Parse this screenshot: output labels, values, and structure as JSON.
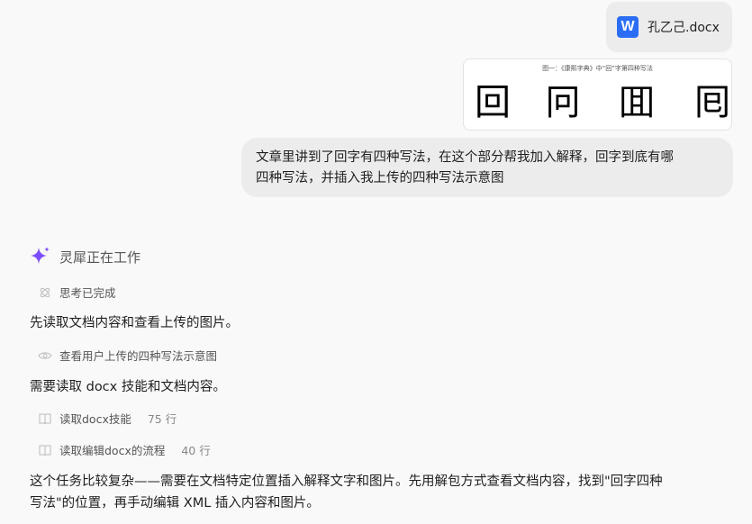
{
  "attachment": {
    "icon_letter": "W",
    "file_name": "孔乙己.docx"
  },
  "image_preview": {
    "caption": "图一：《康熙字典》中“回”字第四种写法",
    "glyphs": [
      "回",
      "冋",
      "囬",
      "囘"
    ]
  },
  "user_message": {
    "line1": "文章里讲到了回字有四种写法，在这个部分帮我加入解释，回字到底有哪",
    "line2": "四种写法，并插入我上传的四种写法示意图"
  },
  "assistant": {
    "status": "灵犀正在工作",
    "thinking_done": "思考已完成",
    "para1": "先读取文档内容和查看上传的图片。",
    "view_image_step": "查看用户上传的四种写法示意图",
    "para2": "需要读取 docx 技能和文档内容。",
    "steps": [
      {
        "label": "读取docx技能",
        "count": "75 行"
      },
      {
        "label": "读取编辑docx的流程",
        "count": "40 行"
      }
    ],
    "para3_line1": "这个任务比较复杂——需要在文档特定位置插入解释文字和图片。先用解包方式查看文档内容，找到\"回字四种",
    "para3_line2": "写法\"的位置，再手动编辑 XML 插入内容和图片。"
  },
  "colors": {
    "accent": "#2b6ef5",
    "sparkle": "#7b4dff"
  }
}
